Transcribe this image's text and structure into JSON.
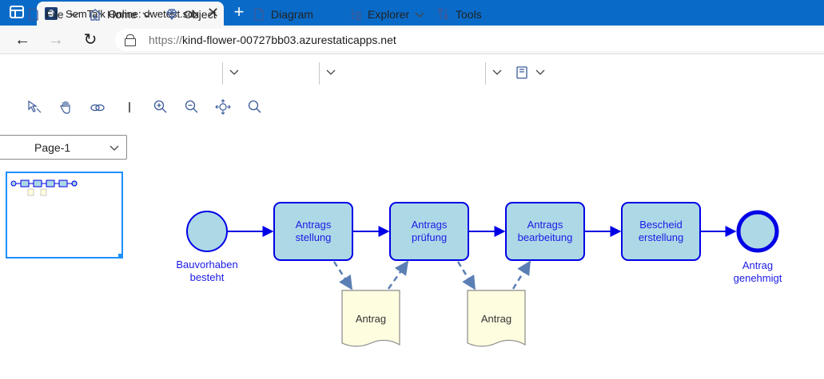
{
  "browser": {
    "tab_title": "SemTalk Online: dwetest.sdx",
    "tab_close": "✕",
    "new_tab": "+",
    "url_scheme": "https://",
    "url_host": "kind-flower-00727bb03.azurestaticapps.net",
    "back": "←",
    "forward": "→",
    "reload": "↻"
  },
  "ribbon": {
    "menus": [
      {
        "label": "File",
        "icon": "file-icon"
      },
      {
        "label": "Home",
        "icon": "home-icon"
      },
      {
        "label": "Object",
        "icon": "diamond-icon"
      },
      {
        "label": "Diagram",
        "icon": "document-icon"
      },
      {
        "label": "Explorer",
        "icon": "tree-icon"
      },
      {
        "label": "Tools",
        "icon": "tools-icon"
      }
    ],
    "extra_menu_icon": "book-icon"
  },
  "toolbar": {
    "tools": [
      "select-pointer-icon",
      "pan-hand-icon",
      "link-icon",
      "cursor-text-icon",
      "zoom-in-icon",
      "zoom-out-icon",
      "fit-page-icon",
      "search-icon"
    ]
  },
  "pages": {
    "selected": "Page-1"
  },
  "diagram": {
    "start_event": {
      "label_line1": "Bauvorhaben",
      "label_line2": "besteht"
    },
    "tasks": [
      {
        "line1": "Antrags",
        "line2": "stellung"
      },
      {
        "line1": "Antrags",
        "line2": "prüfung"
      },
      {
        "line1": "Antrags",
        "line2": "bearbeitung"
      },
      {
        "line1": "Bescheid",
        "line2": "erstellung"
      }
    ],
    "end_event": {
      "label_line1": "Antrag",
      "label_line2": "genehmigt"
    },
    "documents": [
      {
        "label": "Antrag"
      },
      {
        "label": "Antrag"
      }
    ],
    "colors": {
      "task_fill": "#add8e6",
      "stroke": "#0000e6",
      "doc_fill": "#fffde0",
      "doc_stroke": "#8a8a8a",
      "association": "#5b7fb5",
      "label": "#1a1ae6"
    }
  }
}
